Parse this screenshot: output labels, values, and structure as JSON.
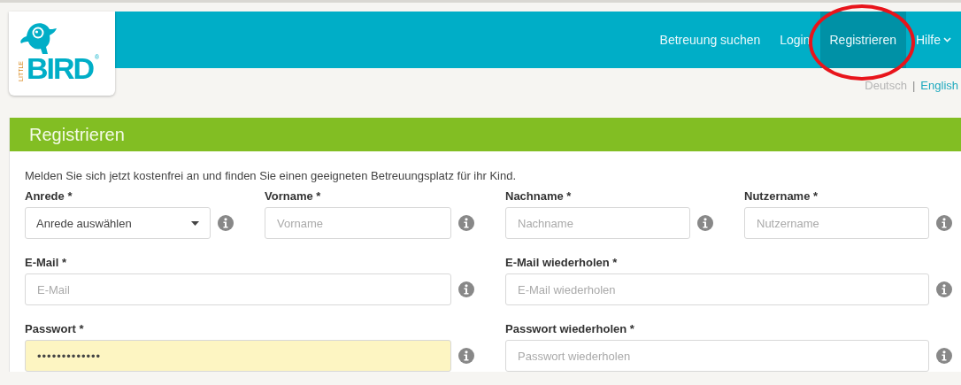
{
  "logo": {
    "tag": "LITTLE",
    "name": "BIRD",
    "mark": "®"
  },
  "nav": [
    {
      "label": "Betreuung suchen",
      "kind": "link",
      "selected": false,
      "circled": false
    },
    {
      "label": "Login",
      "kind": "link",
      "selected": false,
      "circled": false
    },
    {
      "label": "Registrieren",
      "kind": "link",
      "selected": true,
      "circled": true
    },
    {
      "label": "Hilfe",
      "kind": "dropdown",
      "selected": false,
      "circled": false
    }
  ],
  "languages": {
    "separator": "|",
    "items": [
      {
        "label": "Deutsch",
        "selected": true
      },
      {
        "label": "English",
        "selected": false
      }
    ]
  },
  "form": {
    "title": "Registrieren",
    "intro": "Melden Sie sich jetzt kostenfrei an und finden Sie einen geeigneten Betreuungsplatz für ihr Kind.",
    "rows": [
      [
        {
          "kind": "select",
          "label": "Anrede *",
          "value": "Anrede auswählen"
        },
        {
          "kind": "text",
          "label": "Vorname *",
          "placeholder": "Vorname"
        },
        {
          "kind": "text",
          "label": "Nachname *",
          "placeholder": "Nachname"
        },
        {
          "kind": "text",
          "label": "Nutzername *",
          "placeholder": "Nutzername"
        }
      ],
      [
        {
          "kind": "text",
          "label": "E-Mail *",
          "placeholder": "E-Mail"
        },
        {
          "kind": "text",
          "label": "E-Mail wiederholen *",
          "placeholder": "E-Mail wiederholen"
        }
      ],
      [
        {
          "kind": "text",
          "label": "Passwort *",
          "value": "•••••••••••••",
          "autofilled": true
        },
        {
          "kind": "text",
          "label": "Passwort wiederholen *",
          "placeholder": "Passwort wiederholen"
        }
      ]
    ]
  }
}
